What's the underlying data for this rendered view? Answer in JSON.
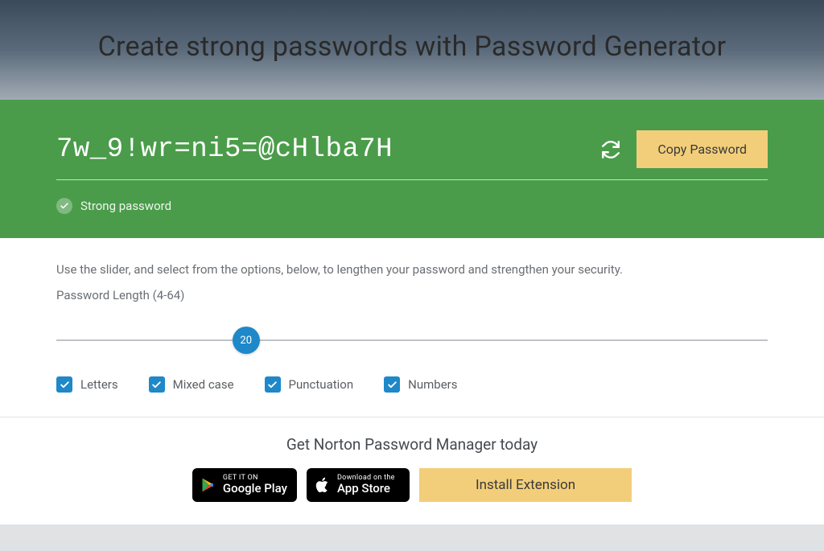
{
  "header": {
    "title": "Create strong passwords with Password Generator"
  },
  "password": {
    "value": "7w_9!wr=ni5=@cHlba7H",
    "copy_label": "Copy Password",
    "strength_label": "Strong password"
  },
  "instructions": "Use the slider, and select from the options, below, to lengthen your password and strengthen your security.",
  "length": {
    "label": "Password Length (4-64)",
    "min": 4,
    "max": 64,
    "value": 20
  },
  "options": [
    {
      "key": "letters",
      "label": "Letters",
      "checked": true
    },
    {
      "key": "mixed_case",
      "label": "Mixed case",
      "checked": true
    },
    {
      "key": "punctuation",
      "label": "Punctuation",
      "checked": true
    },
    {
      "key": "numbers",
      "label": "Numbers",
      "checked": true
    }
  ],
  "footer": {
    "title": "Get Norton Password Manager today",
    "google_play": {
      "top": "GET IT ON",
      "bottom": "Google Play"
    },
    "app_store": {
      "top": "Download on the",
      "bottom": "App Store"
    },
    "install_label": "Install Extension"
  },
  "colors": {
    "accent_green": "#4a9c4a",
    "accent_blue": "#1e88c9",
    "accent_yellow": "#f3ce7a"
  }
}
